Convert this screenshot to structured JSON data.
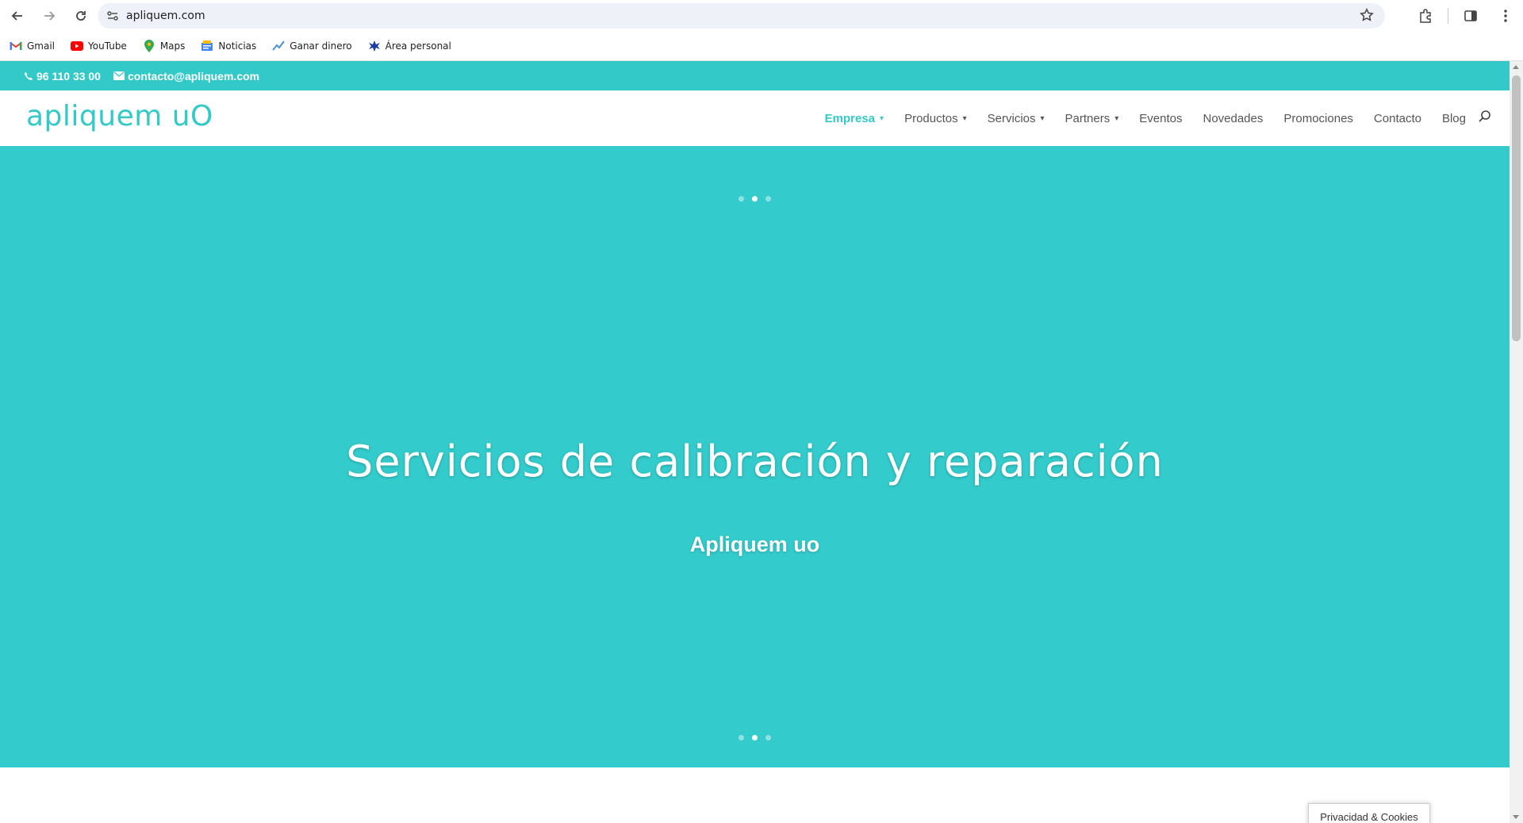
{
  "browser": {
    "url": "apliquem.com",
    "bookmarks": [
      {
        "label": "Gmail",
        "icon": "gmail-icon"
      },
      {
        "label": "YouTube",
        "icon": "youtube-icon"
      },
      {
        "label": "Maps",
        "icon": "maps-icon"
      },
      {
        "label": "Noticias",
        "icon": "news-icon"
      },
      {
        "label": "Ganar dinero",
        "icon": "earn-icon"
      },
      {
        "label": "Área personal",
        "icon": "personal-area-icon"
      }
    ]
  },
  "topbar": {
    "phone": "96 110 33 00",
    "email": "contacto@apliquem.com"
  },
  "header": {
    "logo": "apliquem uO",
    "menu": {
      "empresa": "Empresa",
      "productos": "Productos",
      "servicios": "Servicios",
      "partners": "Partners",
      "eventos": "Eventos",
      "novedades": "Novedades",
      "promociones": "Promociones",
      "contacto": "Contacto",
      "blog": "Blog"
    }
  },
  "hero": {
    "title": "Servicios de calibración y reparación",
    "subtitle": "Apliquem uo",
    "slides_total": 3,
    "active_slide": 2
  },
  "cookie": {
    "label": "Privacidad & Cookies"
  },
  "colors": {
    "brand": "#33c9c9",
    "hero_bg": "#33cbcb"
  }
}
